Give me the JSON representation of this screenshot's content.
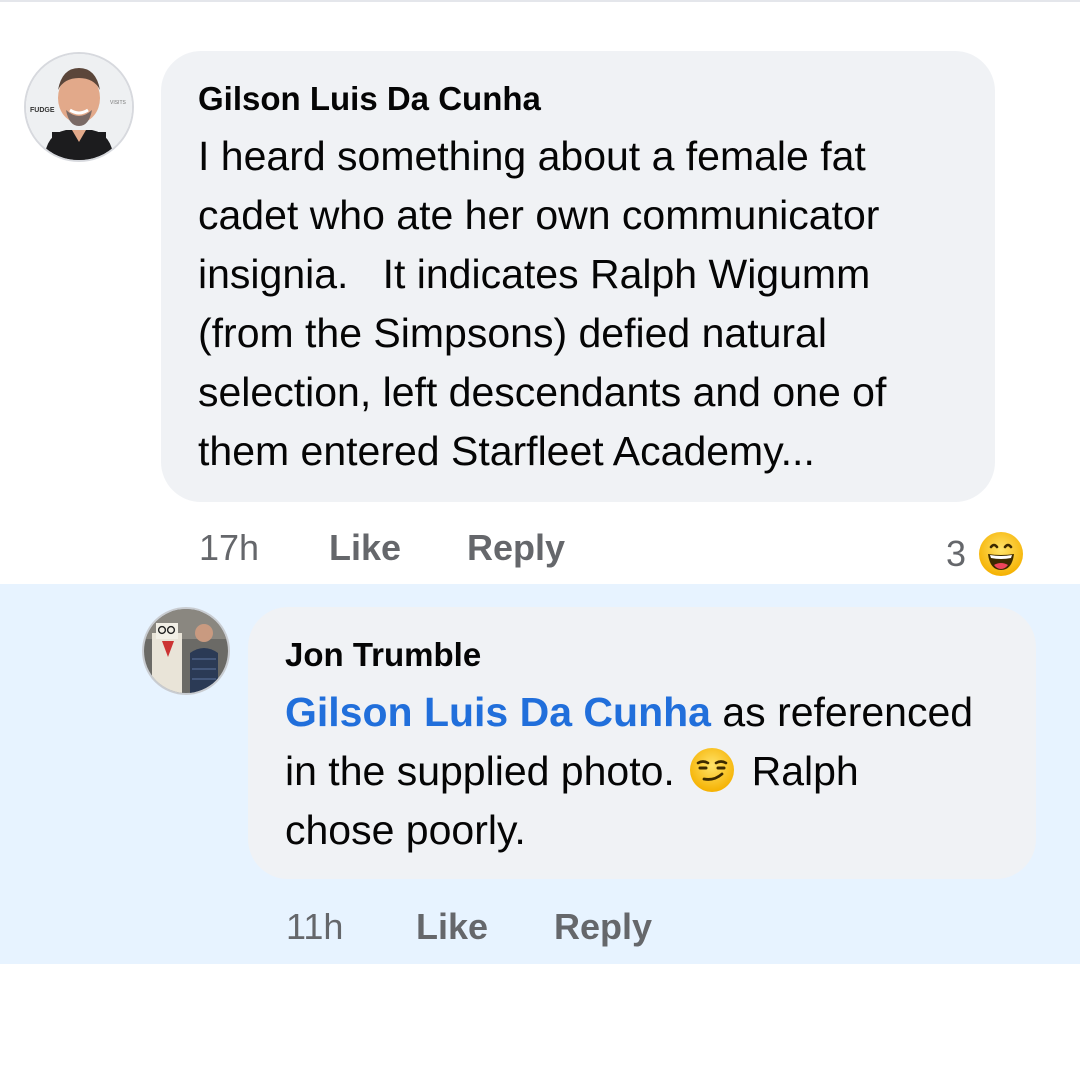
{
  "comment": {
    "author": "Gilson Luis Da Cunha",
    "body_lines": [
      "I heard something about a female fat",
      "cadet who ate her own communicator",
      "insignia.   It indicates Ralph Wigumm",
      "(from the Simpsons) defied natural",
      "selection, left descendants and one of",
      "them entered Starfleet Academy..."
    ],
    "time": "17h",
    "like_label": "Like",
    "reply_label": "Reply",
    "reaction_count": "3",
    "reaction_icon": "laughing-face-emoji",
    "avatar_sign_left": "FUDGE",
    "avatar_sign_right": "VISITS"
  },
  "reply": {
    "author": "Jon Trumble",
    "mention": "Gilson Luis Da Cunha",
    "body_line1_after_mention": " as referenced",
    "body_line2_before_emoji": "in the supplied photo. ",
    "emoji": "smirking-face-emoji",
    "body_line2_after_emoji": " Ralph",
    "body_line3": "chose poorly.",
    "time": "11h",
    "like_label": "Like",
    "reply_label": "Reply"
  },
  "colors": {
    "bubble_bg": "#f0f2f5",
    "reply_highlight_bg": "#e7f3ff",
    "mention_blue": "#216fdb",
    "meta_gray": "#65676b",
    "text": "#050505"
  }
}
